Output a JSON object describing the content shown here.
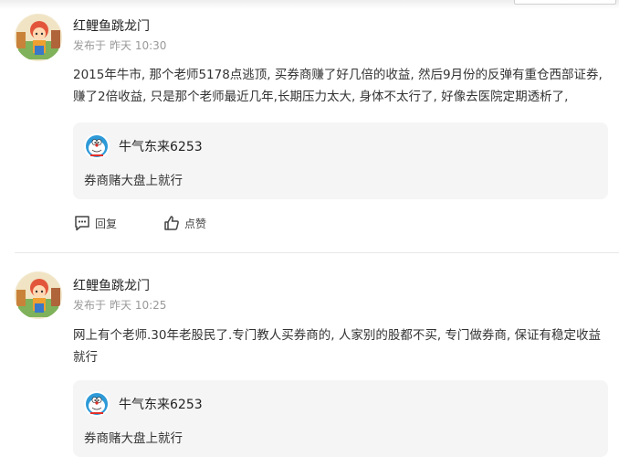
{
  "comments": [
    {
      "username": "红鲤鱼跳龙门",
      "meta_prefix": "发布于",
      "time": "昨天 10:30",
      "text": "2015年牛市, 那个老师5178点逃顶, 买券商赚了好几倍的收益, 然后9月份的反弹有重仓西部证券, 赚了2倍收益, 只是那个老师最近几年,长期压力太大, 身体不太行了, 好像去医院定期透析了,",
      "reply": {
        "username": "牛气东来6253",
        "text": "券商赌大盘上就行"
      },
      "reply_label": "回复",
      "like_label": "点赞"
    },
    {
      "username": "红鲤鱼跳龙门",
      "meta_prefix": "发布于",
      "time": "昨天 10:25",
      "text": "网上有个老师.30年老股民了.专门教人买券商的, 人家别的股都不买, 专门做券商, 保证有稳定收益就行",
      "reply": {
        "username": "牛气东来6253",
        "text": "券商赌大盘上就行"
      }
    }
  ]
}
